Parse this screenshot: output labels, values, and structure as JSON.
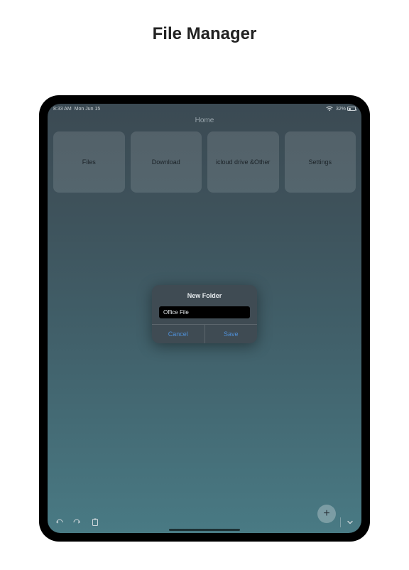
{
  "page_title": "File Manager",
  "status": {
    "time": "8:33 AM",
    "date": "Mon Jun 15",
    "battery": "32%"
  },
  "nav": {
    "title": "Home"
  },
  "tiles": [
    {
      "label": "Files"
    },
    {
      "label": "Download"
    },
    {
      "label": "icloud drive &Other"
    },
    {
      "label": "Settings"
    }
  ],
  "modal": {
    "title": "New Folder",
    "input_value": "Office File",
    "cancel": "Cancel",
    "save": "Save"
  }
}
